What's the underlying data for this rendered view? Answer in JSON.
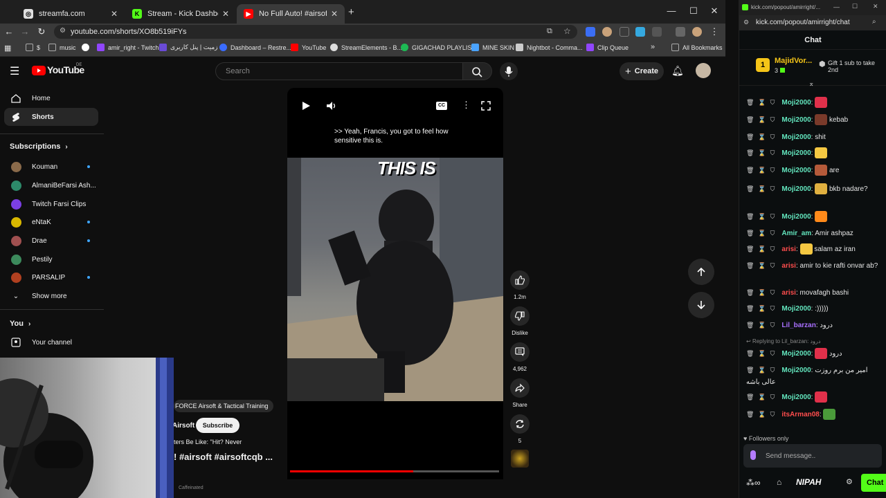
{
  "browser": {
    "tabs": [
      {
        "label": "streamfa.com",
        "color": "#e0e0e0"
      },
      {
        "label": "Stream - Kick Dashboard",
        "color": "#53fc18"
      },
      {
        "label": "No Full Auto! #airsoft #airsoftc",
        "color": "#ff0000"
      }
    ],
    "new_tab": "+",
    "window_controls": {
      "minimize": "—",
      "maximize": "☐",
      "close": "✕"
    },
    "address": "youtube.com/shorts/XO8b519iFYs",
    "bookmarks": [
      {
        "label": "$",
        "color": "#888888"
      },
      {
        "label": "music",
        "color": "#888888"
      },
      {
        "label": "",
        "color": "#ffffff"
      },
      {
        "label": "amir_right - Twitch",
        "color": "#9146ff"
      },
      {
        "label": "زمیت | پنل کاربری",
        "color": "#6a4bd6"
      },
      {
        "label": "Dashboard – Restre...",
        "color": "#3a6cff"
      },
      {
        "label": "YouTube",
        "color": "#ff0000"
      },
      {
        "label": "StreamElements - B...",
        "color": "#dddddd"
      },
      {
        "label": "GIGACHAD PLAYLIS...",
        "color": "#1db954"
      },
      {
        "label": "MINE SKIN",
        "color": "#4aa3ff"
      },
      {
        "label": "Nightbot - Comma...",
        "color": "#cccccc"
      },
      {
        "label": "Clip Queue",
        "color": "#9146ff"
      }
    ],
    "bookmarks_overflow": "»",
    "all_bookmarks": "All Bookmarks"
  },
  "youtube": {
    "logo": "YouTube",
    "region": "DE",
    "search_placeholder": "Search",
    "create_label": "Create",
    "nav": [
      {
        "label": "Home",
        "icon": "home-icon"
      },
      {
        "label": "Shorts",
        "icon": "shorts-icon"
      }
    ],
    "subscriptions_heading": "Subscriptions",
    "subscriptions": [
      {
        "name": "Kouman",
        "color": "#8a6a4a",
        "live": true
      },
      {
        "name": "AlmaniBeFarsi Ash...",
        "color": "#2d8a6a",
        "live": false
      },
      {
        "name": "Twitch Farsi Clips",
        "color": "#7b3fe4",
        "live": false
      },
      {
        "name": "eNtaK",
        "color": "#d9b800",
        "live": true
      },
      {
        "name": "Drae",
        "color": "#a05050",
        "live": true
      },
      {
        "name": "Pestily",
        "color": "#3c8a5c",
        "live": false
      },
      {
        "name": "PARSALIP",
        "color": "#b04020",
        "live": true
      }
    ],
    "show_more": "Show more",
    "you_heading": "You",
    "your_channel": "Your channel",
    "short": {
      "caption": ">> Yeah, Francis, you got to feel how sensitive this is.",
      "overlay_text": "THIS IS",
      "progress_pct": 59,
      "channel_title_partial": "FORCE Airsoft & Tactical Training",
      "channel_handle_partial": "Airsoft",
      "subscribe_label": "Subscribe",
      "desc_partial": "ters Be Like: \"Hit? Never",
      "title_partial": "! #airsoft #airsoftcqb ...",
      "watermark": "Caffeinated"
    },
    "actions": [
      {
        "name": "like",
        "label": "1.2m"
      },
      {
        "name": "dislike",
        "label": "Dislike"
      },
      {
        "name": "comments",
        "label": "4,962"
      },
      {
        "name": "share",
        "label": "Share"
      },
      {
        "name": "remix",
        "label": "5"
      }
    ]
  },
  "kick": {
    "window_title": "kick.com/popout/amirright/...",
    "url": "kick.com/popout/amirright/chat",
    "chat_heading": "Chat",
    "pinned": {
      "rank": "1",
      "user": "MajidVor...",
      "count": "3",
      "gift_text": "Gift 1 sub to take 2nd"
    },
    "messages": [
      {
        "user": "Moji2000",
        "color": "#63e6be",
        "text": "",
        "emote": "#e0304a"
      },
      {
        "user": "Moji2000",
        "color": "#63e6be",
        "text": "kebab",
        "emote": "#7a3a2a"
      },
      {
        "user": "Moji2000",
        "color": "#63e6be",
        "text": "shit",
        "emote": ""
      },
      {
        "user": "Moji2000",
        "color": "#63e6be",
        "text": "",
        "emote": "#f5c842"
      },
      {
        "user": "Moji2000",
        "color": "#63e6be",
        "text": "are",
        "emote": "#b55a3a"
      },
      {
        "user": "Moji2000",
        "color": "#63e6be",
        "text": "bkb nadare?",
        "emote": "#e0b040"
      },
      {
        "user": "Moji2000",
        "color": "#63e6be",
        "text": "",
        "emote": "#ff8a1a"
      },
      {
        "user": "Amir_am",
        "color": "#63e6be",
        "text": "Amir ashpaz",
        "emote": ""
      },
      {
        "user": "arisi",
        "color": "#ff4d4d",
        "text": "salam az iran",
        "emote": "#f5c842"
      },
      {
        "user": "arisi",
        "color": "#ff4d4d",
        "text": "amir to kie rafti onvar ab?",
        "emote": ""
      },
      {
        "user": "arisi",
        "color": "#ff4d4d",
        "text": "movafagh bashi",
        "emote": ""
      },
      {
        "user": "Moji2000",
        "color": "#63e6be",
        "text": ":)))))",
        "emote": ""
      },
      {
        "user": "Lil_barzan",
        "color": "#a970ff",
        "text": "درود",
        "emote": ""
      },
      {
        "user": "Moji2000",
        "color": "#63e6be",
        "text": "درود",
        "emote": "#e0304a"
      },
      {
        "user": "Moji2000",
        "color": "#63e6be",
        "text": "امیر من برم روزت عالی باشه",
        "emote": ""
      },
      {
        "user": "Moji2000",
        "color": "#63e6be",
        "text": "",
        "emote": "#e0304a"
      },
      {
        "user": "itsArman08",
        "color": "#ff4d4d",
        "text": "",
        "emote": "#4a9a3a"
      }
    ],
    "reply_to": "Replying to Lil_barzan: درود",
    "followers_only": "Followers only",
    "input_placeholder": "Send message..",
    "nipah": "NIPAH",
    "chat_button": "Chat"
  }
}
